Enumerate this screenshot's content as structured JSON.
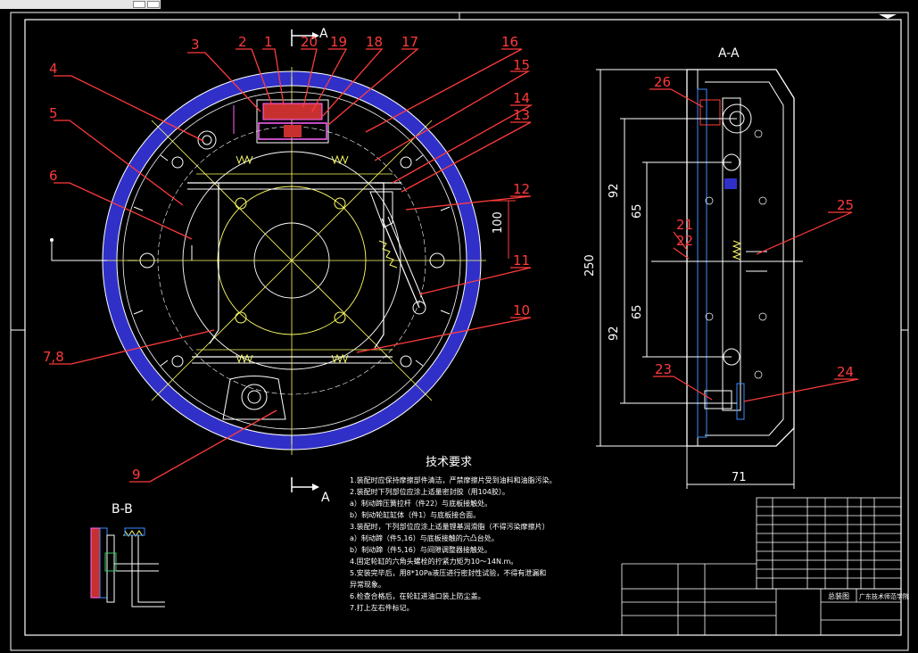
{
  "section_mark": "A",
  "view_aa_title": "A-A",
  "view_bb_title": "B-B",
  "part_labels": [
    "1",
    "2",
    "3",
    "4",
    "5",
    "6",
    "7,8",
    "9",
    "10",
    "11",
    "12",
    "13",
    "14",
    "15",
    "16",
    "17",
    "18",
    "19",
    "20"
  ],
  "section_part_labels": [
    "21",
    "22",
    "23",
    "24",
    "25",
    "26"
  ],
  "dimensions": {
    "d100": "100",
    "d92a": "92",
    "d65a": "65",
    "d250": "250",
    "d65b": "65",
    "d92b": "92",
    "d71": "71"
  },
  "tech": {
    "title": "技术要求",
    "lines": [
      "1.装配时应保持摩擦部件清洁，严禁摩擦片受到油料和油脂污染。",
      "2.装配时下列部位应涂上适量密封胶（用104胶）。",
      "a）制动蹄压簧拉杆（件22）与底板接触处。",
      "b）制动轮缸缸体（件1）与底板接合面。",
      "3.装配时，下列部位应涂上适量锂基润滑脂（不得污染摩擦片）",
      "a）制动蹄（件5,16）与底板接触的六凸台处。",
      "b）制动蹄（件5,16）与间隙调整器接触处。",
      "4.固定轮缸的六角头螺栓的拧紧力矩为10～14N.m。",
      "5.安装完毕后，用8*10Pa液压进行密封性试验，不得有泄漏和",
      "异常现象。",
      "6.检查合格后，在轮缸进油口装上防尘盖。",
      "7.打上左右件标记。"
    ]
  },
  "title_block": {
    "drawing_name": "总装图",
    "unit": "广东技术师范学院"
  }
}
